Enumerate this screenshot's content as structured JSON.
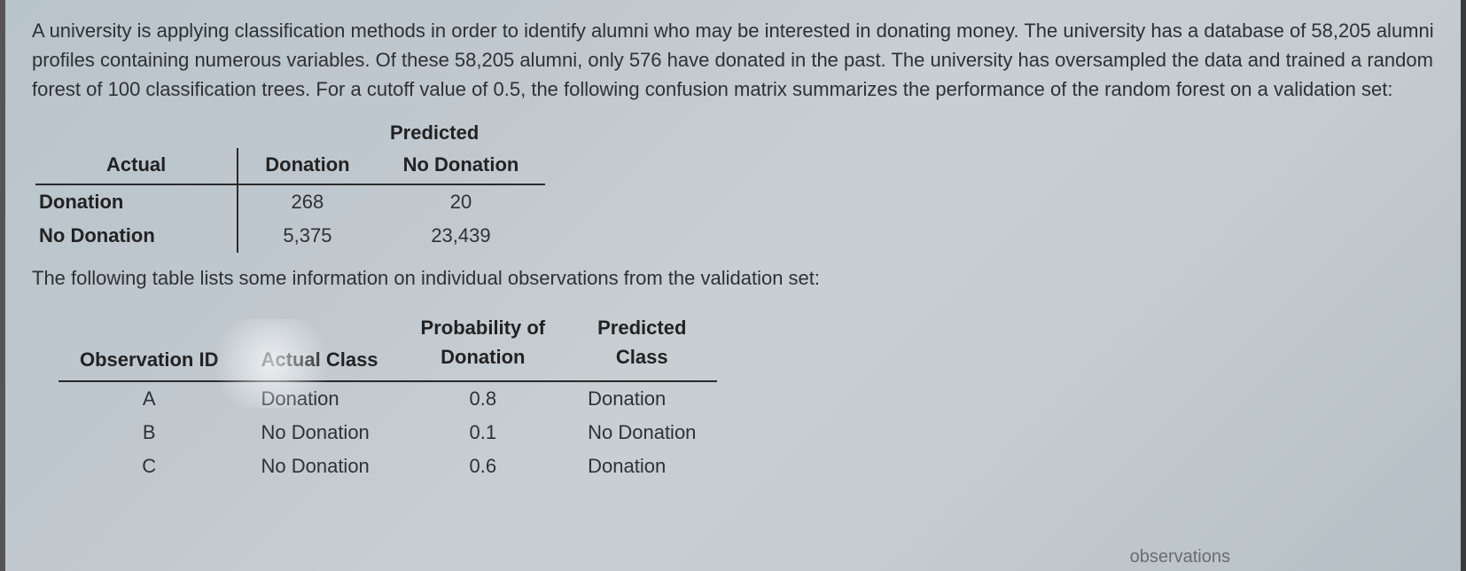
{
  "paragraph1": "A university is applying classification methods in order to identify alumni who may be interested in donating money. The university has a database of 58,205 alumni profiles containing numerous variables. Of these 58,205 alumni, only 576 have donated in the past. The university has oversampled the data and trained a random forest of 100 classification trees. For a cutoff value of 0.5, the following confusion matrix summarizes the performance of the random forest on a validation set:",
  "confusion": {
    "super_header": "Predicted",
    "col_actual": "Actual",
    "col_donation": "Donation",
    "col_nodonation": "No Donation",
    "rows": [
      {
        "label": "Donation",
        "donation": "268",
        "nodonation": "20"
      },
      {
        "label": "No Donation",
        "donation": "5,375",
        "nodonation": "23,439"
      }
    ]
  },
  "paragraph2": "The following table lists some information on individual observations from the validation set:",
  "observations": {
    "col_id": "Observation ID",
    "col_actual": "Actual Class",
    "col_prob_line1": "Probability of",
    "col_prob_line2": "Donation",
    "col_pred_line1": "Predicted",
    "col_pred_line2": "Class",
    "rows": [
      {
        "id": "A",
        "actual": "Donation",
        "prob": "0.8",
        "pred": "Donation"
      },
      {
        "id": "B",
        "actual": "No Donation",
        "prob": "0.1",
        "pred": "No Donation"
      },
      {
        "id": "C",
        "actual": "No Donation",
        "prob": "0.6",
        "pred": "Donation"
      }
    ]
  },
  "partial_footer": "observations"
}
